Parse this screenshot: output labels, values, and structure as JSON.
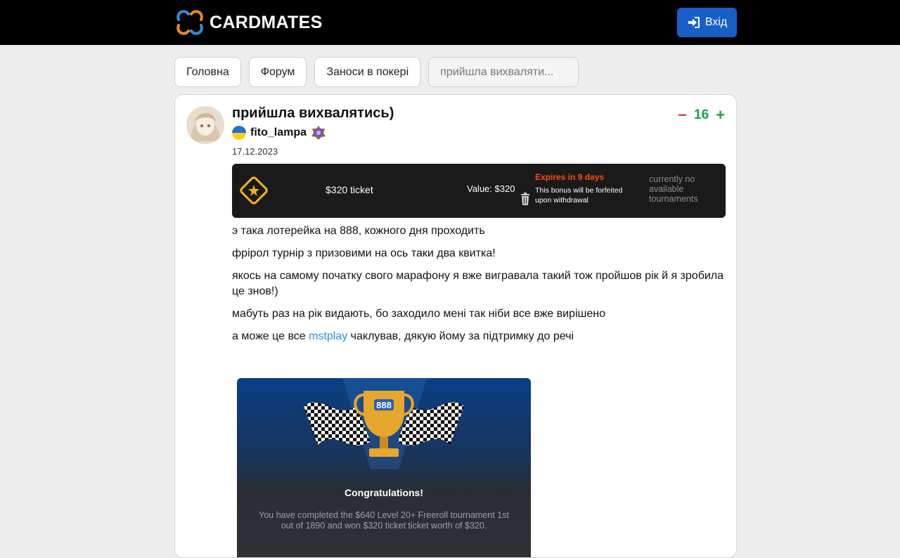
{
  "header": {
    "logo_text": "CARDMATES",
    "login_label": "Вхід"
  },
  "breadcrumbs": [
    {
      "label": "Головна"
    },
    {
      "label": "Форум"
    },
    {
      "label": "Заноси в покері"
    },
    {
      "label": "прийшла вихваляти..."
    }
  ],
  "post": {
    "title": "прийшла вихвалятись)",
    "author": "fito_lampa",
    "date": "17.12.2023",
    "vote": {
      "minus": "−",
      "score": "16",
      "plus": "+"
    },
    "ticket": {
      "name": "$320 ticket",
      "value": "Value: $320",
      "expires": "Expires in 9 days",
      "forfeit_note": "This bonus will be forfeited upon withdrawal",
      "status": "currently no available tournaments"
    },
    "paragraphs": [
      "э така лотерейка на 888, кожного дня проходить",
      "фрірол турнір з призовими на ось таки два квитка!",
      "якось на самому початку свого марафону я вже вигравала такий тож пройшов рік й я зробила це знов!)",
      "мабуть раз на рік видають, бо заходило мені так ніби все вже вирішено"
    ],
    "last_paragraph": {
      "before": "а може це все ",
      "link": "mstplay",
      "after": " чаклував, дякую йому за підтримку до речі"
    },
    "screenshot": {
      "brand": "888",
      "heading": "Congratulations!",
      "text": "You have completed the $640 Level 20+ Freeroll tournament 1st out of 1890 and won $320 ticket ticket worth of $320."
    }
  },
  "colors": {
    "topbar": "#000000",
    "login_button": "#1860c8",
    "vote_minus": "#e03b3b",
    "vote_plus": "#1aa34a",
    "link": "#2f8fe0",
    "expires": "#ff4c16"
  }
}
